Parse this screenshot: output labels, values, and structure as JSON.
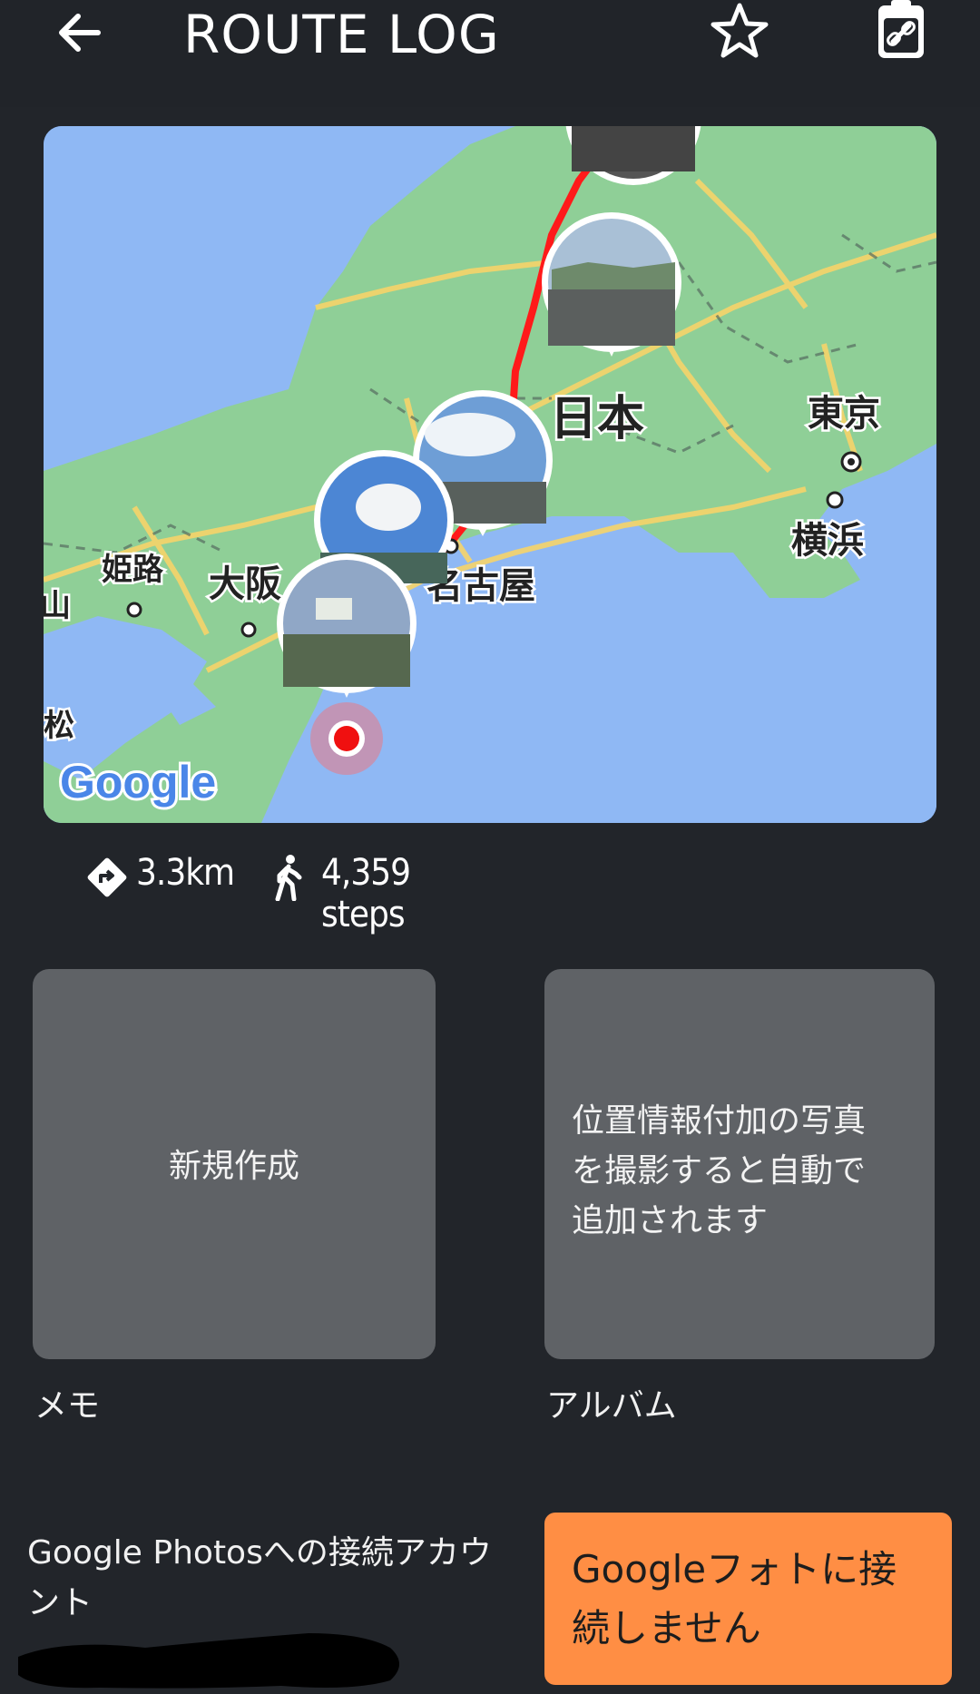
{
  "app_bar": {
    "title": "ROUTE LOG",
    "back_icon": "arrow-left-icon",
    "favorite_icon": "star-outline-icon",
    "share_icon": "clipboard-link-icon"
  },
  "map": {
    "place_labels": [
      "日本",
      "東京",
      "横浜",
      "大阪",
      "名古屋",
      "姫路",
      "山",
      "松"
    ],
    "attribution": "Google",
    "route_color": "#ff1a1a"
  },
  "stats": {
    "distance_icon": "route-sign-icon",
    "distance": "3.3km",
    "steps_icon": "walking-person-icon",
    "steps": "4,359 steps"
  },
  "memo": {
    "card_text": "新規作成",
    "caption": "メモ"
  },
  "album": {
    "card_text": "位置情報付加の写真\nを撮影すると自動で\n追加されます",
    "caption": "アルバム"
  },
  "google_photos": {
    "account_label": "Google Photosへの接続アカウント",
    "connect_button": "Googleフォトに接\n続しません"
  },
  "colors": {
    "background": "#22252a",
    "card": "#5f6266",
    "accent_button": "#ff8e44"
  }
}
